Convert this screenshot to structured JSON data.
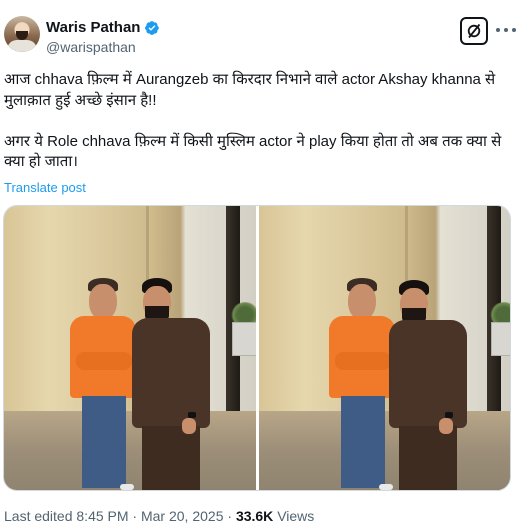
{
  "author": {
    "display_name": "Waris Pathan",
    "handle": "@warispathan",
    "verified": true,
    "avatar_icon": "profile-photo-avatar",
    "verified_icon": "verified-badge-icon",
    "verified_color": "#1d9bf0"
  },
  "header_actions": {
    "grok_icon": "grok-icon",
    "more_icon": "more-options-icon"
  },
  "post": {
    "text_line1": "आज chhava फ़िल्म में Aurangzeb का किरदार निभाने वाले actor Akshay khanna से मुलाक़ात हुई अच्छे इंसान है!!",
    "text_line2": "अगर ये Role chhava फ़िल्म में किसी मुस्लिम actor ने play किया होता तो अब तक क्या से क्या हो जाता।",
    "translate_label": "Translate post"
  },
  "media": {
    "count": 2,
    "images": [
      "photo-1",
      "photo-2"
    ]
  },
  "meta": {
    "last_edited_label": "Last edited",
    "time": "8:45 PM",
    "separator": "·",
    "date": "Mar 20, 2025",
    "views_count": "33.6K",
    "views_label": "Views"
  },
  "colors": {
    "text_primary": "#0f1419",
    "text_secondary": "#536471",
    "link": "#1d9bf0",
    "border": "#cfd9de"
  }
}
